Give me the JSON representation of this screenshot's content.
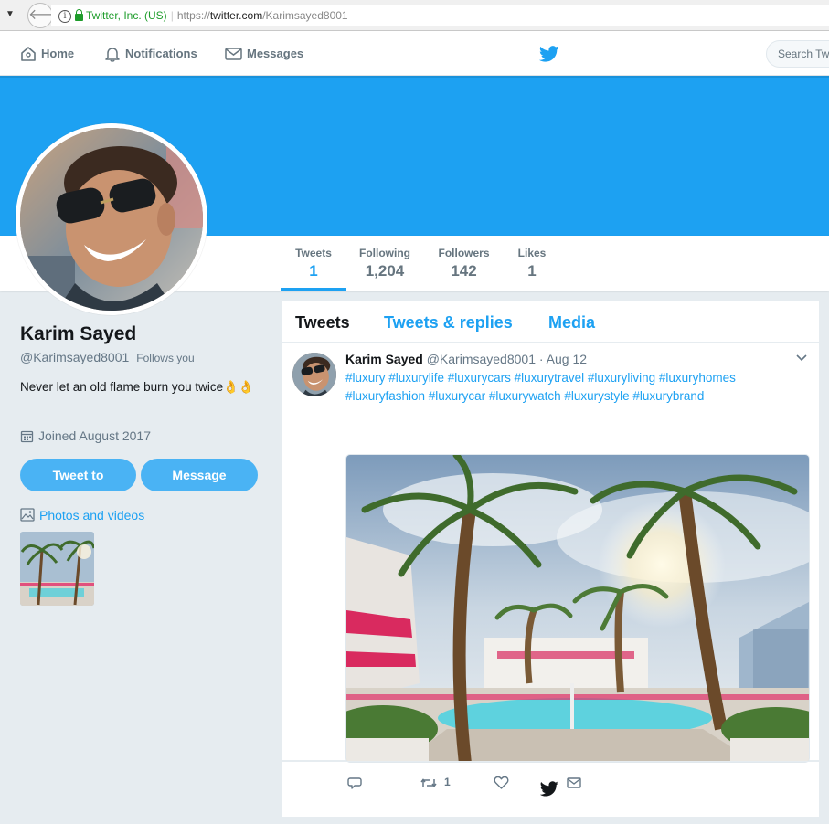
{
  "browser": {
    "org_label": "Twitter, Inc. (US)",
    "url_scheme": "https://",
    "url_host": "twitter.com",
    "url_path": "/Karimsayed8001"
  },
  "nav": {
    "home": "Home",
    "notifications": "Notifications",
    "messages": "Messages",
    "search_placeholder": "Search Twitter"
  },
  "profile": {
    "name": "Karim Sayed",
    "handle": "@Karimsayed8001",
    "follows_you": "Follows you",
    "bio": "Never let an old flame burn you twice👌👌",
    "joined": "Joined August 2017",
    "tweet_to_button": "Tweet to",
    "message_button": "Message",
    "photos_link": "Photos and videos"
  },
  "stats": [
    {
      "label": "Tweets",
      "value": "1"
    },
    {
      "label": "Following",
      "value": "1,204"
    },
    {
      "label": "Followers",
      "value": "142"
    },
    {
      "label": "Likes",
      "value": "1"
    }
  ],
  "tabs": {
    "tweets": "Tweets",
    "replies": "Tweets & replies",
    "media": "Media"
  },
  "tweet": {
    "name": "Karim Sayed",
    "meta": " @Karimsayed8001 · Aug 12",
    "text": "#luxury #luxurylife #luxurycars #luxurytravel #luxuryliving #luxuryhomes #luxuryfashion #luxurycar #luxurywatch #luxurystyle #luxurybrand",
    "retweet_count": "1"
  },
  "colors": {
    "brand_blue": "#1da1f2",
    "button_blue": "#4ab3f4",
    "background": "#e6ecf0"
  },
  "icons": [
    "home-icon",
    "bell-icon",
    "envelope-icon",
    "twitter-bird-icon",
    "calendar-icon",
    "photo-icon",
    "reply-icon",
    "retweet-icon",
    "heart-icon",
    "direct-message-icon",
    "chevron-down-icon"
  ]
}
